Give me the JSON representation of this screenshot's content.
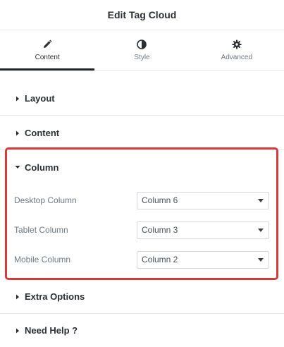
{
  "header": {
    "title": "Edit Tag Cloud"
  },
  "tabs": [
    {
      "label": "Content",
      "icon": "pencil-icon",
      "active": true
    },
    {
      "label": "Style",
      "icon": "contrast-icon",
      "active": false
    },
    {
      "label": "Advanced",
      "icon": "gear-icon",
      "active": false
    }
  ],
  "sections": {
    "layout": "Layout",
    "content": "Content",
    "column": "Column",
    "extra_options": "Extra Options",
    "need_help": "Need Help ?"
  },
  "column_controls": [
    {
      "label": "Desktop Column",
      "value": "Column 6"
    },
    {
      "label": "Tablet Column",
      "value": "Column 3"
    },
    {
      "label": "Mobile Column",
      "value": "Column 2"
    }
  ],
  "colors": {
    "highlight": "#d53a3d",
    "active_tab_underline": "#1d2327"
  }
}
